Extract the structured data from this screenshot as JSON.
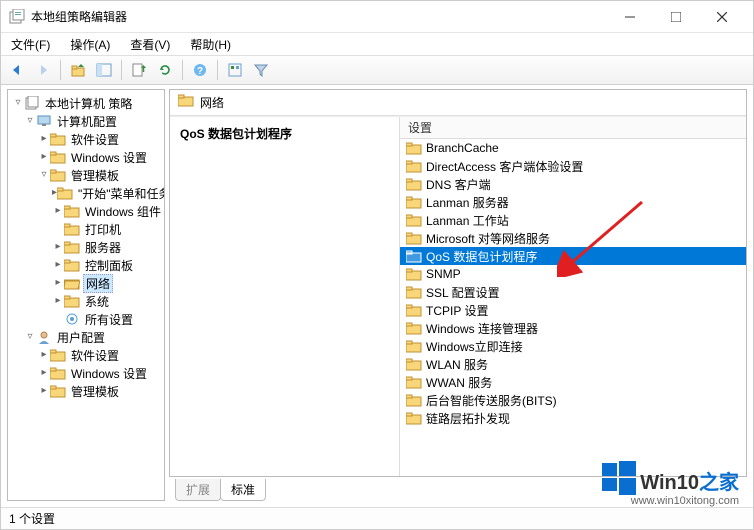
{
  "window": {
    "title": "本地组策略编辑器"
  },
  "menubar": [
    {
      "label": "文件(F)"
    },
    {
      "label": "操作(A)"
    },
    {
      "label": "查看(V)"
    },
    {
      "label": "帮助(H)"
    }
  ],
  "tree": {
    "root": "本地计算机 策略",
    "computer_config": "计算机配置",
    "software_settings": "软件设置",
    "windows_settings": "Windows 设置",
    "admin_templates": "管理模板",
    "start_menu": "\"开始\"菜单和任务栏",
    "windows_components": "Windows 组件",
    "printers": "打印机",
    "servers": "服务器",
    "control_panel": "控制面板",
    "network": "网络",
    "system": "系统",
    "all_settings": "所有设置",
    "user_config": "用户配置",
    "u_software": "软件设置",
    "u_windows": "Windows 设置",
    "u_admin": "管理模板"
  },
  "content": {
    "header": "网络",
    "detail_title": "QoS 数据包计划程序",
    "list_header": "设置",
    "items": [
      {
        "label": "BranchCache",
        "selected": false
      },
      {
        "label": "DirectAccess 客户端体验设置",
        "selected": false
      },
      {
        "label": "DNS 客户端",
        "selected": false
      },
      {
        "label": "Lanman 服务器",
        "selected": false
      },
      {
        "label": "Lanman 工作站",
        "selected": false
      },
      {
        "label": "Microsoft 对等网络服务",
        "selected": false
      },
      {
        "label": "QoS 数据包计划程序",
        "selected": true
      },
      {
        "label": "SNMP",
        "selected": false
      },
      {
        "label": "SSL 配置设置",
        "selected": false
      },
      {
        "label": "TCPIP 设置",
        "selected": false
      },
      {
        "label": "Windows 连接管理器",
        "selected": false
      },
      {
        "label": "Windows立即连接",
        "selected": false
      },
      {
        "label": "WLAN 服务",
        "selected": false
      },
      {
        "label": "WWAN 服务",
        "selected": false
      },
      {
        "label": "后台智能传送服务(BITS)",
        "selected": false
      },
      {
        "label": "链路层拓扑发现",
        "selected": false
      }
    ]
  },
  "tabs": [
    {
      "label": "扩展",
      "active": false
    },
    {
      "label": "标准",
      "active": true
    }
  ],
  "statusbar": "1 个设置",
  "watermark": {
    "brand_left": "Win10",
    "brand_right": "之家",
    "url": "www.win10xitong.com"
  },
  "colors": {
    "selection": "#0078d7",
    "folder": "#f7d77a",
    "folder_dark": "#d6a93a"
  }
}
